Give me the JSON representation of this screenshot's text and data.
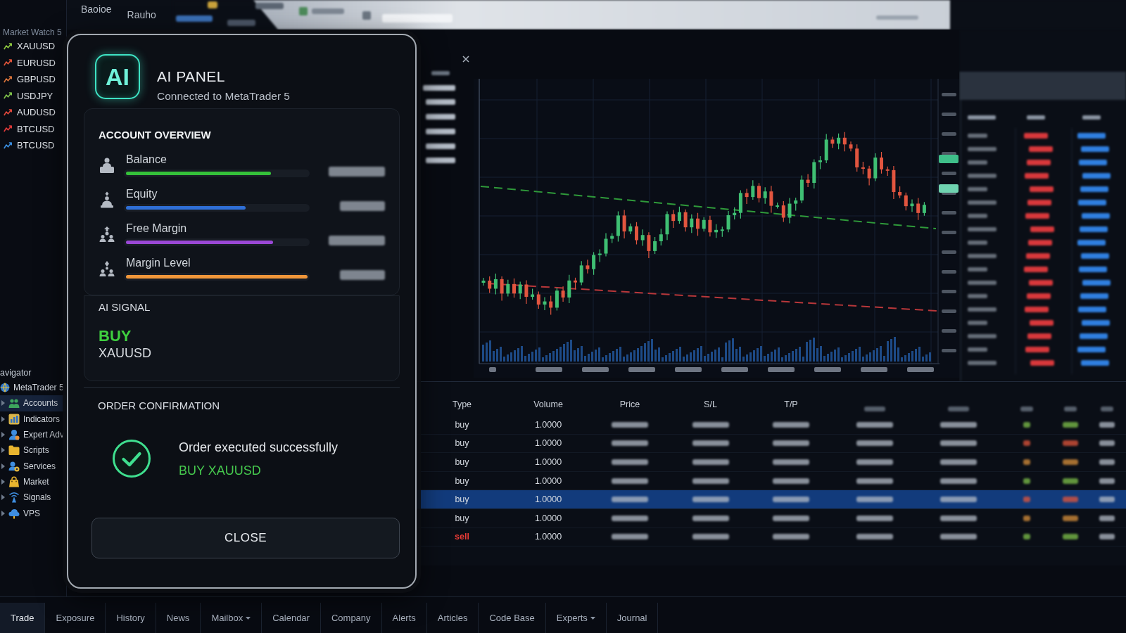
{
  "menu_bar": [
    "Baoioe",
    "Rauho"
  ],
  "market_watch": {
    "title": "Market Watch 5",
    "symbols": [
      {
        "name": "XAUUSD",
        "color": "#8cc63f"
      },
      {
        "name": "EURUSD",
        "color": "#e2553a"
      },
      {
        "name": "GBPUSD",
        "color": "#d9733a"
      },
      {
        "name": "USDJPY",
        "color": "#7fc24a"
      },
      {
        "name": "AUDUSD",
        "color": "#e0483c"
      },
      {
        "name": "BTCUSD",
        "color": "#e23a3a"
      },
      {
        "name": "BTCUSD",
        "color": "#3a8fe2"
      }
    ]
  },
  "ai_panel": {
    "logo": "AI",
    "title": "AI PANEL",
    "subtitle": "Connected to MetaTrader 5",
    "account_overview": {
      "title": "ACCOUNT OVERVIEW",
      "metrics": [
        {
          "label": "Balance",
          "level": 0.8,
          "color": "#35c23a"
        },
        {
          "label": "Equity",
          "level": 0.66,
          "color": "#2f6fd6"
        },
        {
          "label": "Free Margin",
          "level": 0.81,
          "color": "#9a48d6"
        },
        {
          "label": "Margin Level",
          "level": 1.0,
          "color": "#f0963a"
        }
      ]
    },
    "signal": {
      "title": "AI SIGNAL",
      "action": "BUY",
      "symbol": "XAUUSD"
    },
    "order_confirmation": {
      "title": "ORDER CONFIRMATION",
      "message": "Order executed successfully",
      "detail": "BUY XAUUSD"
    },
    "close_button": "CLOSE"
  },
  "navigator": {
    "title": "avigator",
    "items": [
      {
        "label": "MetaTrader 5",
        "selected": false,
        "children": [
          {
            "label": "Accounts",
            "selected": true
          },
          {
            "label": "Indicators",
            "selected": false
          },
          {
            "label": "Expert Adv",
            "selected": false
          },
          {
            "label": "Scripts",
            "selected": false
          },
          {
            "label": "Services",
            "selected": false
          },
          {
            "label": "Market",
            "selected": false
          },
          {
            "label": "Signals",
            "selected": false
          },
          {
            "label": "VPS",
            "selected": false
          }
        ]
      }
    ]
  },
  "trade_table": {
    "columns": [
      "Type",
      "Volume",
      "Price",
      "S/L",
      "T/P"
    ],
    "rows": [
      {
        "type": "buy",
        "kind": "buy",
        "volume": "1.0000",
        "selected": false
      },
      {
        "type": "buy",
        "kind": "buy",
        "volume": "1.0000",
        "selected": false
      },
      {
        "type": "buy",
        "kind": "buy",
        "volume": "1.0000",
        "selected": false
      },
      {
        "type": "buy",
        "kind": "buy",
        "volume": "1.0000",
        "selected": false
      },
      {
        "type": "buy",
        "kind": "buy",
        "volume": "1.0000",
        "selected": true
      },
      {
        "type": "buy",
        "kind": "buy",
        "volume": "1.0000",
        "selected": false
      },
      {
        "type": "sell",
        "kind": "sell",
        "volume": "1.0000",
        "selected": false
      }
    ]
  },
  "bottom_tabs": [
    {
      "label": "Trade",
      "selected": true,
      "has_menu": false
    },
    {
      "label": "Exposure",
      "selected": false,
      "has_menu": false
    },
    {
      "label": "History",
      "selected": false,
      "has_menu": false
    },
    {
      "label": "News",
      "selected": false,
      "has_menu": false
    },
    {
      "label": "Mailbox",
      "selected": false,
      "has_menu": true
    },
    {
      "label": "Calendar",
      "selected": false,
      "has_menu": false
    },
    {
      "label": "Company",
      "selected": false,
      "has_menu": false
    },
    {
      "label": "Alerts",
      "selected": false,
      "has_menu": false
    },
    {
      "label": "Articles",
      "selected": false,
      "has_menu": false
    },
    {
      "label": "Code Base",
      "selected": false,
      "has_menu": false
    },
    {
      "label": "Experts",
      "selected": false,
      "has_menu": true
    },
    {
      "label": "Journal",
      "selected": false,
      "has_menu": false
    }
  ]
}
